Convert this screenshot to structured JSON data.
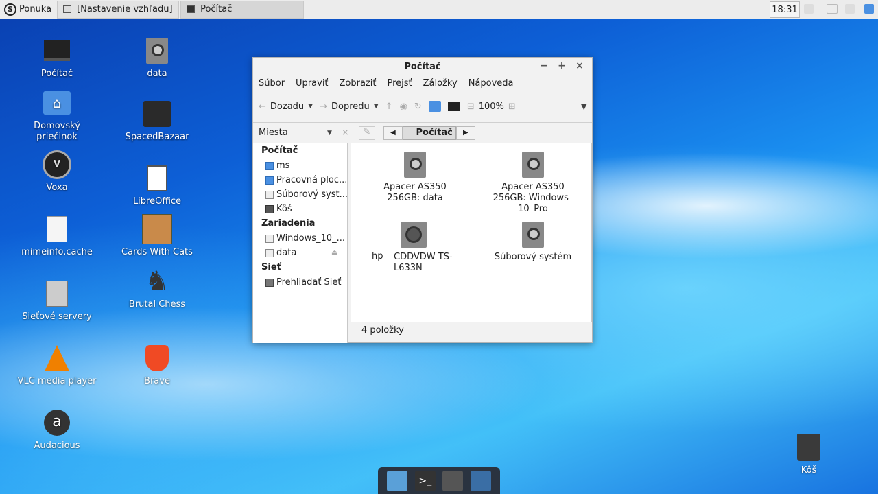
{
  "top_panel": {
    "menu_label": "Ponuka",
    "tasks": [
      "[Nastavenie vzhľadu]",
      "Počítač"
    ],
    "clock": "18:31"
  },
  "desktop": {
    "left": [
      {
        "label": "Počítač",
        "icon": "monitor-icon"
      },
      {
        "label": "Domovský priečinok",
        "icon": "home-folder-icon"
      },
      {
        "label": "Voxa",
        "icon": "voxa-icon"
      },
      {
        "label": "mimeinfo.cache",
        "icon": "document-icon"
      },
      {
        "label": "Sieťové servery",
        "icon": "server-icon"
      },
      {
        "label": "VLC media player",
        "icon": "vlc-icon"
      },
      {
        "label": "Audacious",
        "icon": "audacious-icon"
      }
    ],
    "right": [
      {
        "label": "data",
        "icon": "drive-icon"
      },
      {
        "label": "SpacedBazaar",
        "icon": "spacedbazaar-icon"
      },
      {
        "label": "LibreOffice",
        "icon": "libreoffice-icon"
      },
      {
        "label": "Cards With Cats",
        "icon": "cat-icon"
      },
      {
        "label": "Brutal Chess",
        "icon": "chess-knight-icon"
      },
      {
        "label": "Brave",
        "icon": "brave-icon"
      }
    ],
    "trash": "Kôš"
  },
  "window": {
    "title": "Počítač",
    "menu": [
      "Súbor",
      "Upraviť",
      "Zobraziť",
      "Prejsť",
      "Záložky",
      "Nápoveda"
    ],
    "toolbar": {
      "back": "Dozadu",
      "forward": "Dopredu",
      "zoom": "100%"
    },
    "location": {
      "places_label": "Miesta",
      "crumb": "Počítač"
    },
    "sidebar": {
      "sections": [
        {
          "title": "Počítač",
          "items": [
            "ms",
            "Pracovná ploc...",
            "Súborový syst...",
            "Kôš"
          ]
        },
        {
          "title": "Zariadenia",
          "items": [
            "Windows_10_...",
            "data"
          ]
        },
        {
          "title": "Sieť",
          "items": [
            "Prehliadať Sieť"
          ]
        }
      ]
    },
    "items": [
      "Apacer AS350 256GB: data",
      "Apacer AS350 256GB: Windows_ 10_Pro",
      "CDDVDW TS-L633N",
      "Súborový systém"
    ],
    "hp_label": "hp",
    "status": "4 položky"
  }
}
